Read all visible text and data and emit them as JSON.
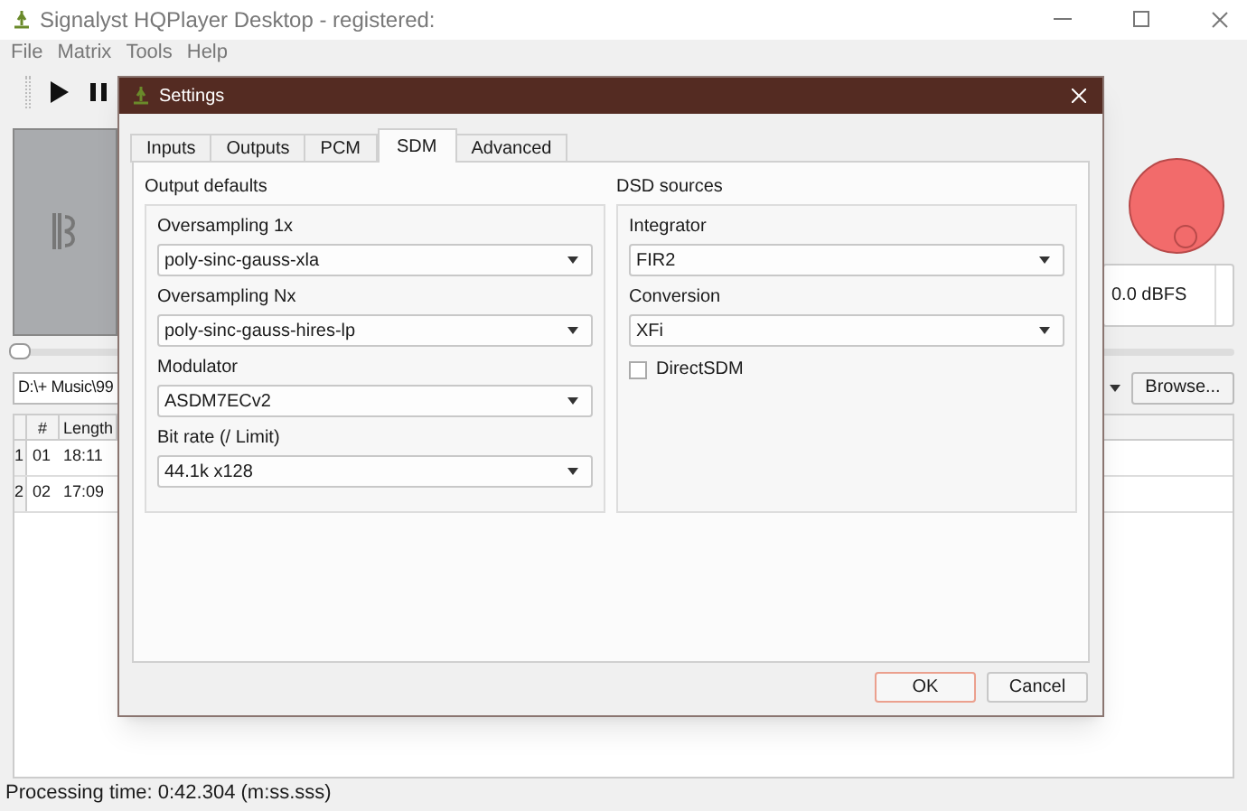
{
  "window": {
    "title": "Signalyst HQPlayer Desktop - registered:"
  },
  "menu": [
    {
      "label": "File"
    },
    {
      "label": "Matrix"
    },
    {
      "label": "Tools"
    },
    {
      "label": "Help"
    }
  ],
  "toolbar": [
    {
      "kind": "play"
    },
    {
      "kind": "pause"
    }
  ],
  "volume": {
    "reading": "0.0 dBFS"
  },
  "seek": {
    "level": 0
  },
  "path_field": {
    "value": "D:\\+ Music\\99"
  },
  "browse_button": "Browse...",
  "tracks": {
    "columns": [
      "#",
      "Length"
    ],
    "rows": [
      {
        "number": "1",
        "cells": [
          "01",
          "18:11"
        ]
      },
      {
        "number": "2",
        "cells": [
          "02",
          "17:09"
        ]
      }
    ]
  },
  "status_bar": "Processing time: 0:42.304 (m:ss.sss)",
  "dialog": {
    "title": "Settings",
    "tabs": [
      {
        "label": "Inputs",
        "selected": false
      },
      {
        "label": "Outputs",
        "selected": false
      },
      {
        "label": "PCM",
        "selected": false
      },
      {
        "label": "SDM",
        "selected": true
      },
      {
        "label": "Advanced",
        "selected": false
      }
    ],
    "groups": [
      {
        "title": "Output defaults",
        "fields": [
          {
            "kind": "select",
            "label": "Oversampling 1x",
            "value": "poly-sinc-gauss-xla"
          },
          {
            "kind": "select",
            "label": "Oversampling Nx",
            "value": "poly-sinc-gauss-hires-lp"
          },
          {
            "kind": "select",
            "label": "Modulator",
            "value": "ASDM7ECv2"
          },
          {
            "kind": "select",
            "label": "Bit rate (/ Limit)",
            "value": "44.1k x128"
          }
        ]
      },
      {
        "title": "DSD sources",
        "fields": [
          {
            "kind": "select",
            "label": "Integrator",
            "value": "FIR2"
          },
          {
            "kind": "select",
            "label": "Conversion",
            "value": "XFi"
          },
          {
            "kind": "checkbox",
            "label": "DirectSDM",
            "checked": false
          }
        ]
      }
    ],
    "buttons": [
      {
        "label": "OK",
        "default": true
      },
      {
        "label": "Cancel",
        "default": false
      }
    ]
  }
}
